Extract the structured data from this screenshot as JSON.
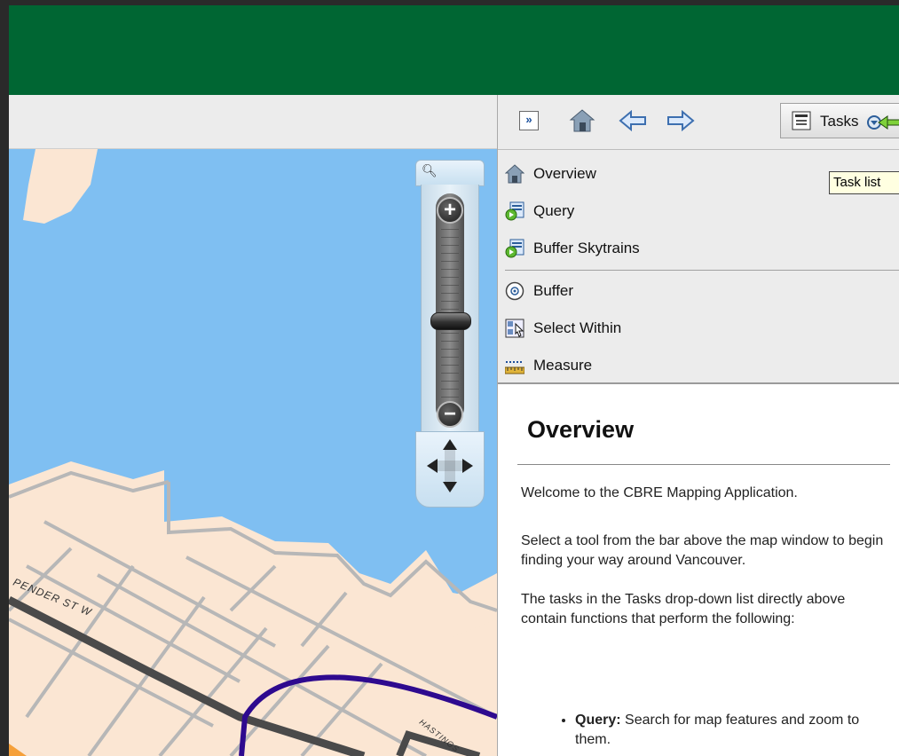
{
  "colors": {
    "banner": "#006633",
    "water": "#7fbff2",
    "land": "#fbe6d3",
    "street": "#b7b7b7",
    "road_dark": "#4a4a4a",
    "route": "#2e0a8f",
    "highway": "#f5a03a"
  },
  "map": {
    "street_labels": {
      "pender": "PENDER ST W",
      "hastings": "HASTINGS"
    }
  },
  "zoom_control": {
    "zoom_in": "+",
    "zoom_out": "−",
    "magnifier_icon": "search-icon"
  },
  "panel_toolbar": {
    "expand_label": "»",
    "tasks_label": "Tasks",
    "tooltip": "Task list"
  },
  "task_menu": {
    "items": [
      {
        "label": "Overview",
        "icon": "home-icon"
      },
      {
        "label": "Query",
        "icon": "query-icon"
      },
      {
        "label": "Buffer Skytrains",
        "icon": "query-icon"
      },
      {
        "label": "Buffer",
        "icon": "buffer-icon"
      },
      {
        "label": "Select Within",
        "icon": "select-within-icon"
      },
      {
        "label": "Measure",
        "icon": "ruler-icon"
      }
    ]
  },
  "content": {
    "title": "Overview",
    "welcome": "Welcome to the CBRE Mapping Application.",
    "para1": "Select a tool from the bar above the map window to begin finding your way around Vancouver.",
    "para2": "The tasks in the Tasks drop-down list directly above contain functions that perform the following:",
    "bullets": [
      {
        "term": "Query:",
        "text": " Search for map features and zoom to them."
      }
    ]
  }
}
